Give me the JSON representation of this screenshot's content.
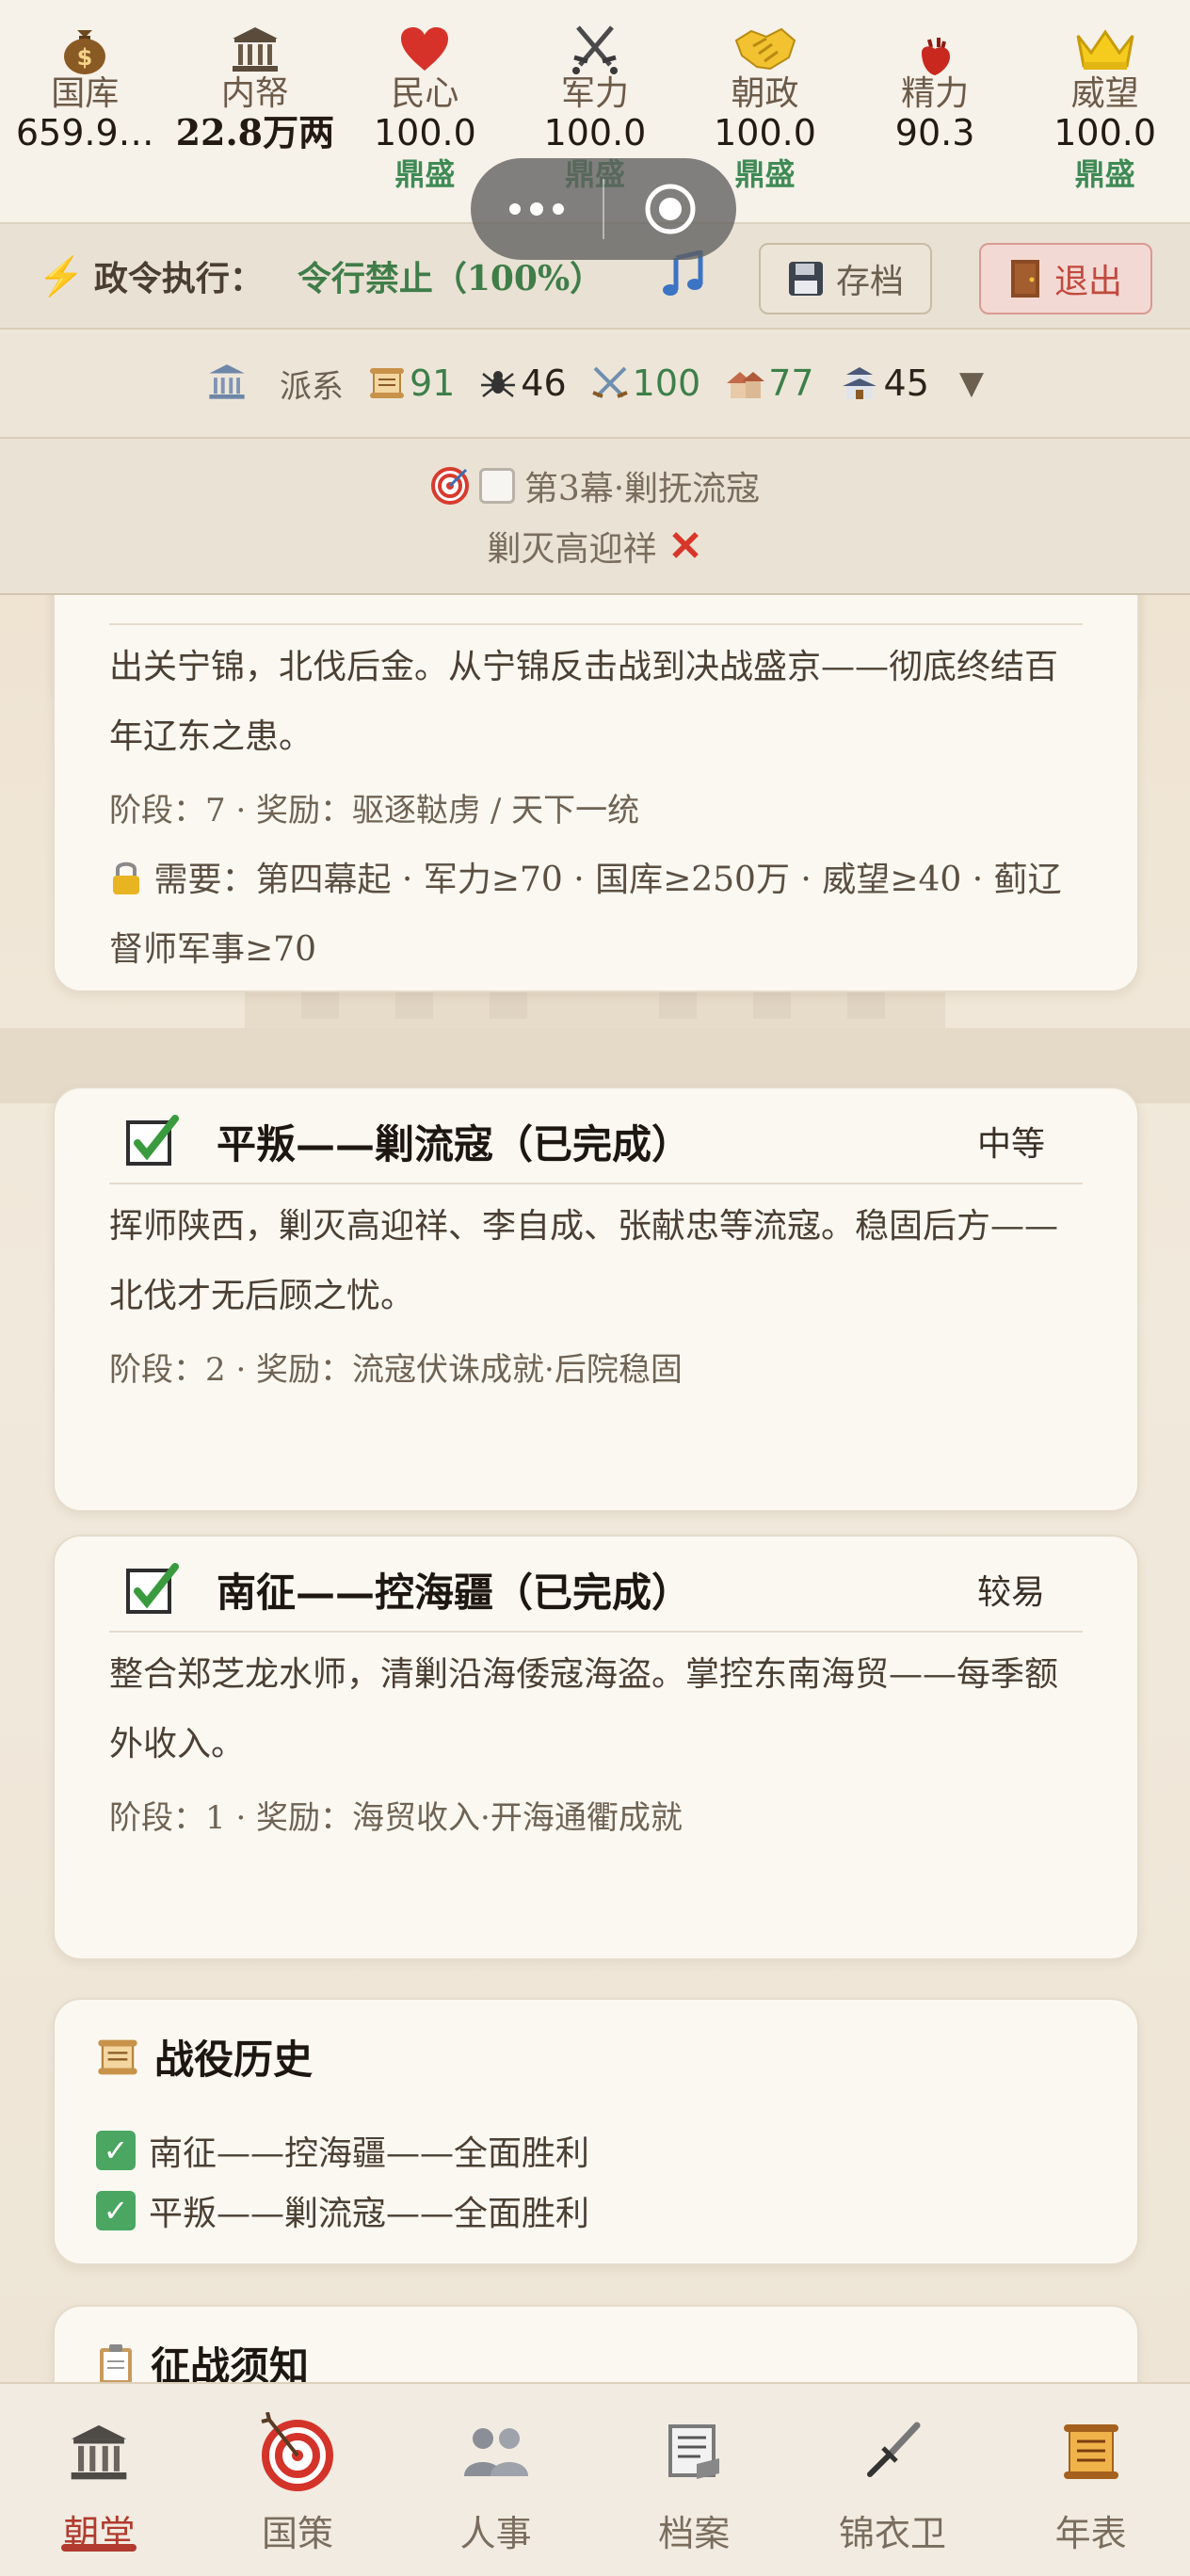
{
  "stats": [
    {
      "key": "treasury",
      "icon": "money-bag-icon",
      "label": "国库",
      "value": "659.9…",
      "status": ""
    },
    {
      "key": "privy_purse",
      "icon": "building-icon",
      "label": "内帑",
      "value": "22.8万两",
      "status": ""
    },
    {
      "key": "people",
      "icon": "heart-icon",
      "label": "民心",
      "value": "100.0",
      "status": "鼎盛"
    },
    {
      "key": "military",
      "icon": "crossed-swords-icon",
      "label": "军力",
      "value": "100.0",
      "status": "鼎盛"
    },
    {
      "key": "court",
      "icon": "handshake-icon",
      "label": "朝政",
      "value": "100.0",
      "status": "鼎盛"
    },
    {
      "key": "energy",
      "icon": "anatomical-heart-icon",
      "label": "精力",
      "value": "90.3",
      "status": ""
    },
    {
      "key": "prestige",
      "icon": "crown-icon",
      "label": "威望",
      "value": "100.0",
      "status": "鼎盛"
    }
  ],
  "command": {
    "label": "政令执行：",
    "value": "令行禁止（100%）",
    "save_label": "存档",
    "exit_label": "退出"
  },
  "factions": {
    "label": "派系",
    "items": [
      {
        "icon": "scroll-icon",
        "value": "91",
        "tone": "green"
      },
      {
        "icon": "spider-icon",
        "value": "46",
        "tone": "dark"
      },
      {
        "icon": "crossed-swords-icon",
        "value": "100",
        "tone": "green"
      },
      {
        "icon": "house-icon",
        "value": "77",
        "tone": "green"
      },
      {
        "icon": "castle-icon",
        "value": "45",
        "tone": "dark"
      }
    ]
  },
  "objective": {
    "act": "第3幕·剿抚流寇",
    "task": "剿灭高迎祥"
  },
  "campaigns": {
    "north": {
      "desc": "出关宁锦，北伐后金。从宁锦反击战到决战盛京——彻底终结百年辽东之患。",
      "meta": "阶段：7 · 奖励：驱逐鞑虏 / 天下一统",
      "requirement": "需要：第四幕起 · 军力≥70 · 国库≥250万 · 威望≥40 · 蓟辽督师军事≥70"
    },
    "rebels": {
      "title": "平叛——剿流寇（已完成）",
      "difficulty": "中等",
      "desc": "挥师陕西，剿灭高迎祥、李自成、张献忠等流寇。稳固后方——北伐才无后顾之忧。",
      "meta": "阶段：2 · 奖励：流寇伏诛成就·后院稳固"
    },
    "south": {
      "title": "南征——控海疆（已完成）",
      "difficulty": "较易",
      "desc": "整合郑芝龙水师，清剿沿海倭寇海盗。掌控东南海贸——每季额外收入。",
      "meta": "阶段：1 · 奖励：海贸收入·开海通衢成就"
    }
  },
  "history": {
    "title": "战役历史",
    "items": [
      "南征——控海疆——全面胜利",
      "平叛——剿流寇——全面胜利"
    ]
  },
  "notice": {
    "title": "征战须知"
  },
  "nav": [
    {
      "label": "朝堂",
      "icon": "court-icon",
      "active": true
    },
    {
      "label": "国策",
      "icon": "target-icon",
      "active": false
    },
    {
      "label": "人事",
      "icon": "people-icon",
      "active": false
    },
    {
      "label": "档案",
      "icon": "archive-icon",
      "active": false
    },
    {
      "label": "锦衣卫",
      "icon": "dagger-icon",
      "active": false
    },
    {
      "label": "年表",
      "icon": "scroll-icon",
      "active": false
    }
  ]
}
